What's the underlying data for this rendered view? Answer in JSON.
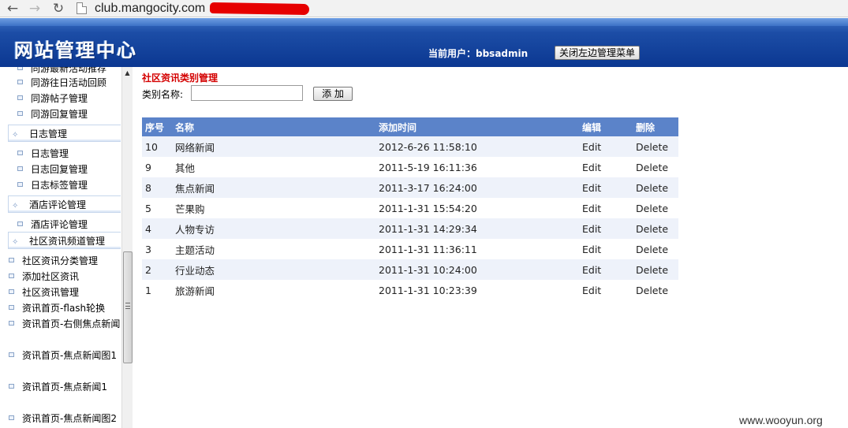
{
  "browser": {
    "url": "club.mangocity.com"
  },
  "header": {
    "site_title": "网站管理中心",
    "current_user": "当前用户：bbsadmin",
    "close_menu_button": "关闭左边管理菜单"
  },
  "sidebar": {
    "top_partial": "同游最新活动推荐",
    "items_a": [
      "同游往日活动回顾",
      "同游帖子管理",
      "同游回复管理"
    ],
    "group_log": "日志管理",
    "items_b": [
      "日志管理",
      "日志回复管理",
      "日志标签管理"
    ],
    "group_hotel": "酒店评论管理",
    "items_c": [
      "酒店评论管理"
    ],
    "group_news": "社区资讯频道管理",
    "items_d": [
      "社区资讯分类管理",
      "添加社区资讯",
      "社区资讯管理",
      "资讯首页-flash轮换",
      "资讯首页-右侧焦点新闻"
    ],
    "items_e": [
      "资讯首页-焦点新闻图1",
      "资讯首页-焦点新闻1",
      "资讯首页-焦点新闻图2"
    ]
  },
  "main": {
    "page_title": "社区资讯类别管理",
    "field_label": "类别名称:",
    "name_input_value": "",
    "add_button": "添 加",
    "columns": [
      "序号",
      "名称",
      "添加时间",
      "编辑",
      "删除"
    ],
    "rows": [
      {
        "id": "10",
        "name": "网络新闻",
        "time": "2012-6-26 11:58:10",
        "edit": "Edit",
        "delete": "Delete"
      },
      {
        "id": "9",
        "name": "其他",
        "time": "2011-5-19 16:11:36",
        "edit": "Edit",
        "delete": "Delete"
      },
      {
        "id": "8",
        "name": "焦点新闻",
        "time": "2011-3-17 16:24:00",
        "edit": "Edit",
        "delete": "Delete"
      },
      {
        "id": "5",
        "name": "芒果购",
        "time": "2011-1-31 15:54:20",
        "edit": "Edit",
        "delete": "Delete"
      },
      {
        "id": "4",
        "name": "人物专访",
        "time": "2011-1-31 14:29:34",
        "edit": "Edit",
        "delete": "Delete"
      },
      {
        "id": "3",
        "name": "主题活动",
        "time": "2011-1-31 11:36:11",
        "edit": "Edit",
        "delete": "Delete"
      },
      {
        "id": "2",
        "name": "行业动态",
        "time": "2011-1-31 10:24:00",
        "edit": "Edit",
        "delete": "Delete"
      },
      {
        "id": "1",
        "name": "旅游新闻",
        "time": "2011-1-31 10:23:39",
        "edit": "Edit",
        "delete": "Delete"
      }
    ]
  },
  "watermark": "www.wooyun.org",
  "colors": {
    "header_blue": "#0b3791",
    "table_header": "#5b83c9",
    "row_alt": "#eef2fa",
    "title_red": "#d40000"
  }
}
